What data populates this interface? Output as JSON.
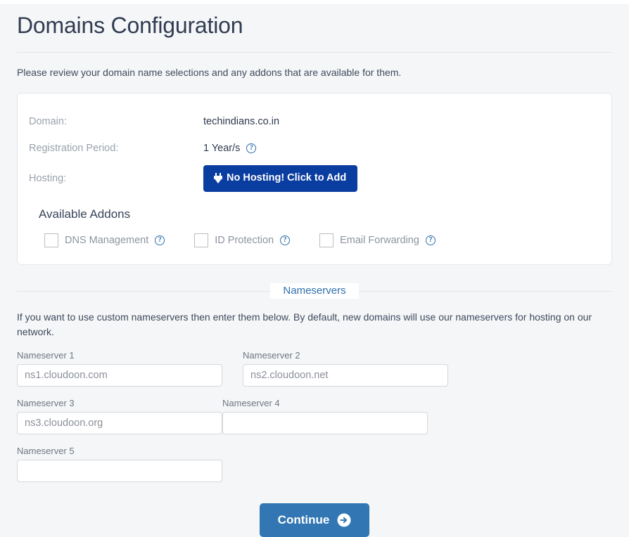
{
  "page": {
    "title": "Domains Configuration",
    "intro": "Please review your domain name selections and any addons that are available for them."
  },
  "domain_card": {
    "rows": [
      {
        "label": "Domain:",
        "value": "techindians.co.in"
      },
      {
        "label": "Registration Period:",
        "value": "1 Year/s"
      },
      {
        "label": "Hosting:",
        "value": ""
      }
    ],
    "hosting_button_label": "No Hosting! Click to Add",
    "hosting_button_icon": "plug-icon",
    "hosting_button_color": "#0a3da0",
    "registration_help_icon": "help-circle-icon",
    "addons_title": "Available Addons",
    "addons": [
      {
        "label": "DNS Management",
        "checked": false,
        "help_icon": "help-circle-icon"
      },
      {
        "label": "ID Protection",
        "checked": false,
        "help_icon": "help-circle-icon"
      },
      {
        "label": "Email Forwarding",
        "checked": false,
        "help_icon": "help-circle-icon"
      }
    ]
  },
  "nameservers": {
    "legend": "Nameservers",
    "description": "If you want to use custom nameservers then enter them below. By default, new domains will use our nameservers for hosting on our network.",
    "fields": [
      {
        "label": "Nameserver 1",
        "value": "ns1.cloudoon.com"
      },
      {
        "label": "Nameserver 2",
        "value": "ns2.cloudoon.net"
      },
      {
        "label": "Nameserver 3",
        "value": "ns3.cloudoon.org"
      },
      {
        "label": "Nameserver 4",
        "value": ""
      },
      {
        "label": "Nameserver 5",
        "value": ""
      }
    ]
  },
  "footer": {
    "continue_label": "Continue",
    "continue_icon": "arrow-right-circle-icon",
    "continue_color": "#3277b3"
  }
}
